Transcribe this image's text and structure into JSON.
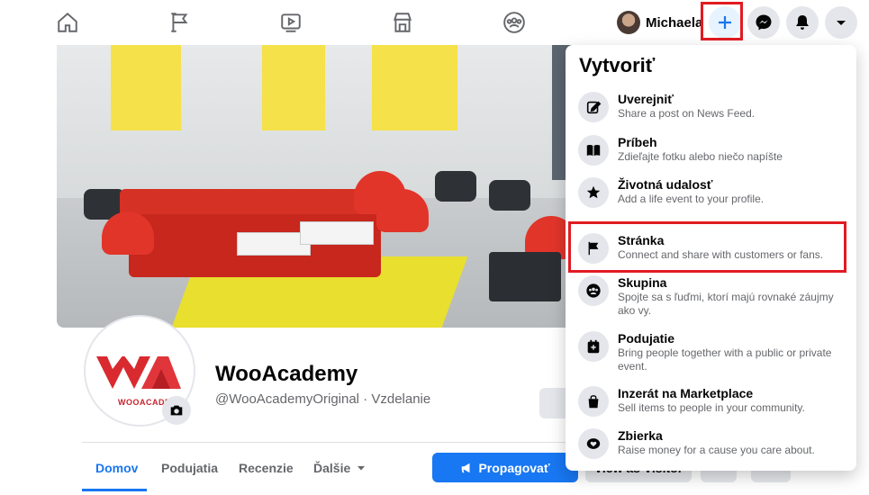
{
  "nav": {
    "icons": [
      "home-icon",
      "flag-icon",
      "watch-icon",
      "marketplace-icon",
      "groups-icon"
    ],
    "user_name": "Michaela",
    "right_icons": [
      "create-plus-icon",
      "messenger-icon",
      "notifications-bell-icon",
      "account-menu-icon"
    ],
    "accent": "#1877f2"
  },
  "page": {
    "title": "WooAcademy",
    "subtitle": "@WooAcademyOriginal · Vzdelanie",
    "logo_text": "WOOACADE",
    "tabs": [
      "Domov",
      "Podujatia",
      "Recenzie",
      "Ďalšie"
    ],
    "active_tab": "Domov",
    "promote_label": "Propagovať",
    "view_as_visitor_label": "View as Visitor"
  },
  "dropdown": {
    "title": "Vytvoriť",
    "items": [
      {
        "label": "Uverejniť",
        "desc": "Share a post on News Feed.",
        "icon": "compose-icon"
      },
      {
        "label": "Príbeh",
        "desc": "Zdieľajte fotku alebo niečo napíšte",
        "icon": "book-icon"
      },
      {
        "label": "Životná udalosť",
        "desc": "Add a life event to your profile.",
        "icon": "star-icon"
      },
      {
        "label": "Stránka",
        "desc": "Connect and share with customers or fans.",
        "icon": "flag-icon"
      },
      {
        "label": "Skupina",
        "desc": "Spojte sa s ľuďmi, ktorí majú rovnaké záujmy ako vy.",
        "icon": "group-icon"
      },
      {
        "label": "Podujatie",
        "desc": "Bring people together with a public or private event.",
        "icon": "event-icon"
      },
      {
        "label": "Inzerát na Marketplace",
        "desc": "Sell items to people in your community.",
        "icon": "shopping-bag-icon"
      },
      {
        "label": "Zbierka",
        "desc": "Raise money for a cause you care about.",
        "icon": "fundraiser-icon"
      }
    ]
  },
  "highlight_color": "#e11b22"
}
